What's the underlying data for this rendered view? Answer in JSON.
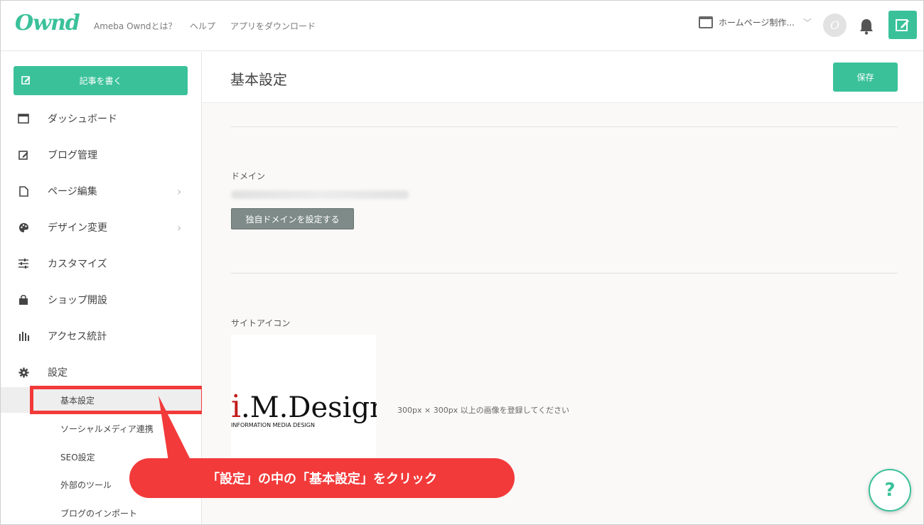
{
  "header": {
    "logo": "Ownd",
    "nav": [
      "Ameba Owndとは？",
      "ヘルプ",
      "アプリをダウンロード"
    ],
    "site_selector": "ホームページ制作...",
    "avatar_letter": "O"
  },
  "sidebar": {
    "write_button": "記事を書く",
    "items": [
      {
        "label": "ダッシュボード",
        "icon": "browser-window-icon"
      },
      {
        "label": "ブログ管理",
        "icon": "edit-icon"
      },
      {
        "label": "ページ編集",
        "icon": "page-icon",
        "chevron": "›"
      },
      {
        "label": "デザイン変更",
        "icon": "palette-icon",
        "chevron": "›"
      },
      {
        "label": "カスタマイズ",
        "icon": "sliders-icon"
      },
      {
        "label": "ショップ開設",
        "icon": "shopping-bag-icon"
      },
      {
        "label": "アクセス統計",
        "icon": "bar-chart-icon"
      },
      {
        "label": "設定",
        "icon": "gear-icon"
      }
    ],
    "sub_items": [
      {
        "label": "基本設定",
        "active": true
      },
      {
        "label": "ソーシャルメディア連携"
      },
      {
        "label": "SEO設定"
      },
      {
        "label": "外部のツール"
      },
      {
        "label": "ブログのインポート"
      }
    ]
  },
  "main": {
    "title": "基本設定",
    "save_button": "保存",
    "domain_label": "ドメイン",
    "custom_domain_button": "独自ドメインを設定する",
    "site_icon_label": "サイトアイコン",
    "site_icon_logo": "i.M.Design",
    "site_icon_logo_sub": "INFORMATION MEDIA DESIGN",
    "site_icon_hint": "300px × 300px 以上の画像を登録してください"
  },
  "annotation": {
    "callout": "「設定」の中の「基本設定」をクリック",
    "color": "#f23a3a"
  },
  "help_button": "?",
  "colors": {
    "brand": "#3ac19a",
    "sidebar_active": "#eeeeee",
    "secondary_button": "#7e8b88"
  }
}
